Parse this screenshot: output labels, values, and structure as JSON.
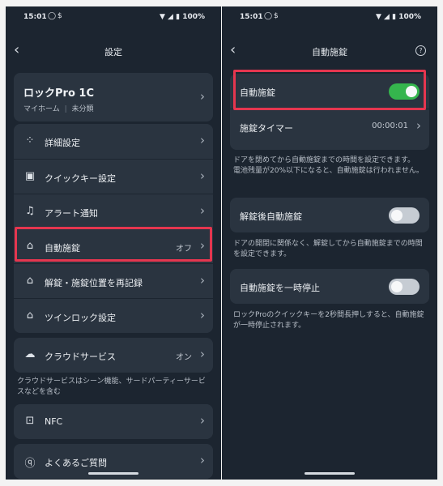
{
  "left": {
    "status": {
      "time": "15:01",
      "battery": "100%"
    },
    "title": "設定",
    "device": {
      "name": "ロックPro 1C",
      "home": "マイホーム",
      "category": "未分類"
    },
    "menu": [
      {
        "label": "詳細設定",
        "icon": "grid-icon"
      },
      {
        "label": "クイックキー設定",
        "icon": "quick-key-icon"
      },
      {
        "label": "アラート通知",
        "icon": "bell-icon"
      },
      {
        "label": "自動施錠",
        "icon": "auto-lock-icon",
        "value": "オフ"
      },
      {
        "label": "解錠・施錠位置を再記録",
        "icon": "lock-refresh-icon"
      },
      {
        "label": "ツインロック設定",
        "icon": "twin-lock-icon"
      }
    ],
    "cloud": {
      "label": "クラウドサービス",
      "value": "オン",
      "note": "クラウドサービスはシーン機能、サードパーティーサービスなどを含む"
    },
    "nfc": {
      "label": "NFC"
    },
    "faq": {
      "label": "よくあるご質問"
    }
  },
  "right": {
    "status": {
      "time": "15:01",
      "battery": "100%"
    },
    "title": "自動施錠",
    "auto_lock": {
      "label": "自動施錠",
      "enabled": true
    },
    "timer": {
      "label": "施錠タイマー",
      "value": "00:00:01"
    },
    "timer_note": "ドアを閉めてから自動施錠までの時間を設定できます。\n電池残量が20%以下になると、自動施錠は行われません。",
    "after_unlock": {
      "label": "解錠後自動施錠",
      "enabled": false
    },
    "after_unlock_note": "ドアの開閉に関係なく、解錠してから自動施錠までの時間を設定できます。",
    "pause": {
      "label": "自動施錠を一時停止",
      "enabled": false
    },
    "pause_note": "ロックProのクイックキーを2秒間長押しすると、自動施錠が一時停止されます。"
  },
  "colors": {
    "background": "#1c2530",
    "card": "#2a3440",
    "highlight": "#e5364f",
    "toggle_on": "#35b54d"
  }
}
